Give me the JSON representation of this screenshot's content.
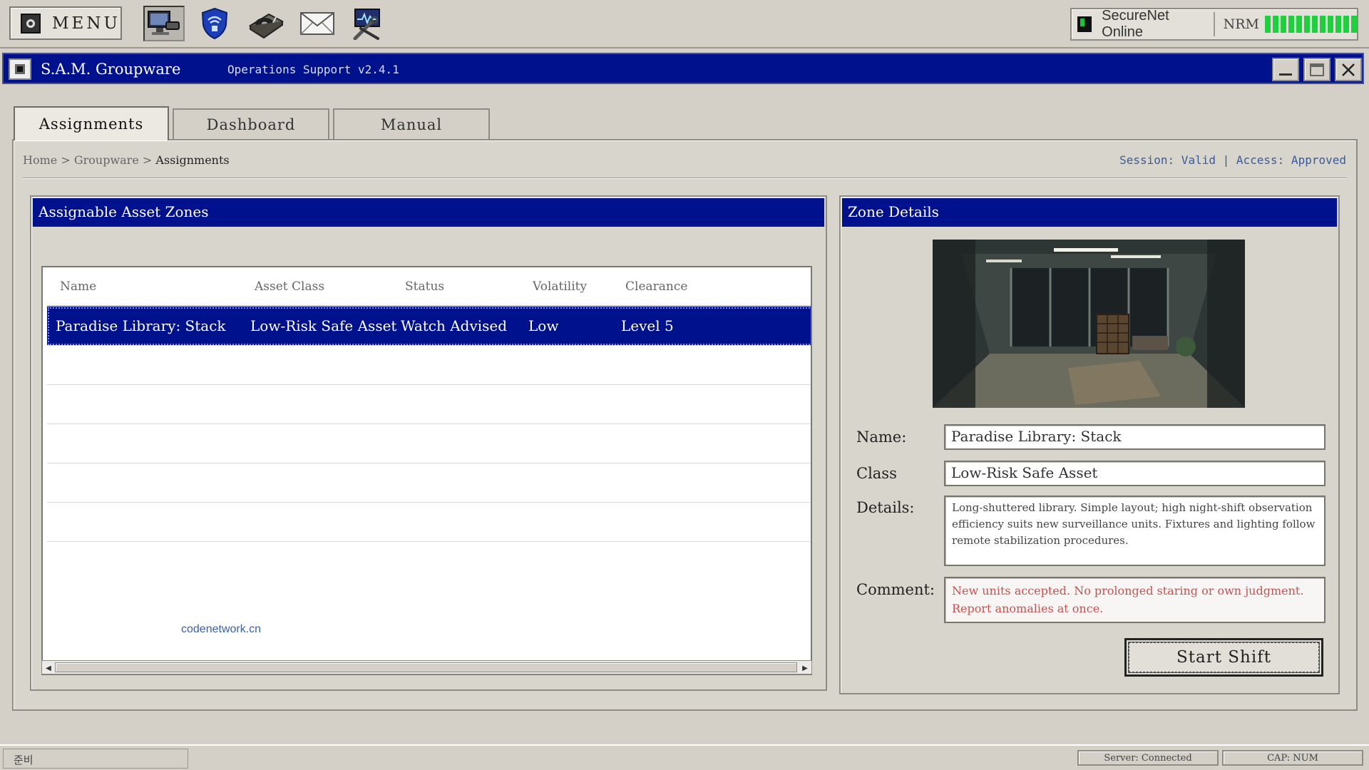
{
  "taskbar": {
    "menu_label": "MENU",
    "apps": [
      {
        "icon": "cctv-monitor-icon"
      },
      {
        "icon": "shield-wifi-icon"
      },
      {
        "icon": "turntable-icon"
      },
      {
        "icon": "mail-icon"
      },
      {
        "icon": "diagnostics-tools-icon"
      }
    ],
    "tray": {
      "network_status": "SecureNet Online",
      "nrm_label": "NRM",
      "nrm_level": 1.0,
      "status_color": "#1ed03e"
    }
  },
  "window": {
    "title": "S.A.M. Groupware",
    "subtitle": "Operations Support v2.4.1",
    "controls": [
      "minimize",
      "maximize",
      "close"
    ],
    "accent_color": "#00118e"
  },
  "tabs": [
    {
      "label": "Assignments",
      "active": true
    },
    {
      "label": "Dashboard",
      "active": false
    },
    {
      "label": "Manual",
      "active": false
    }
  ],
  "breadcrumb": {
    "home": "Home",
    "sep": ">",
    "section": "Groupware",
    "current": "Assignments"
  },
  "session_info": "Session: Valid | Access: Approved",
  "zones_panel": {
    "title": "Assignable Asset Zones",
    "columns": [
      "Name",
      "Asset Class",
      "Status",
      "Volatility",
      "Clearance"
    ],
    "rows": [
      {
        "name": "Paradise Library: Stack",
        "asset_class": "Low-Risk Safe Asset",
        "status": "Watch Advised",
        "volatility": "Low",
        "clearance": "Level 5",
        "selected": true
      }
    ],
    "watermark": "codenetwork.cn"
  },
  "details_panel": {
    "title": "Zone Details",
    "name_label": "Name:",
    "name_value": "Paradise Library: Stack",
    "class_label": "Class",
    "class_value": "Low-Risk Safe Asset",
    "details_label": "Details:",
    "details_value": "Long-shuttered library. Simple layout; high night-shift observation efficiency suits new surveillance units. Fixtures and lighting follow remote stabilization procedures.",
    "comment_label": "Comment:",
    "comment_value": "New units accepted. No prolonged staring or own judgment. Report anomalies at once.",
    "comment_color": "#c85050",
    "start_button": "Start Shift"
  },
  "statusbar": {
    "ready": "준비",
    "server": "Server: Connected",
    "caps": "CAP: NUM"
  }
}
